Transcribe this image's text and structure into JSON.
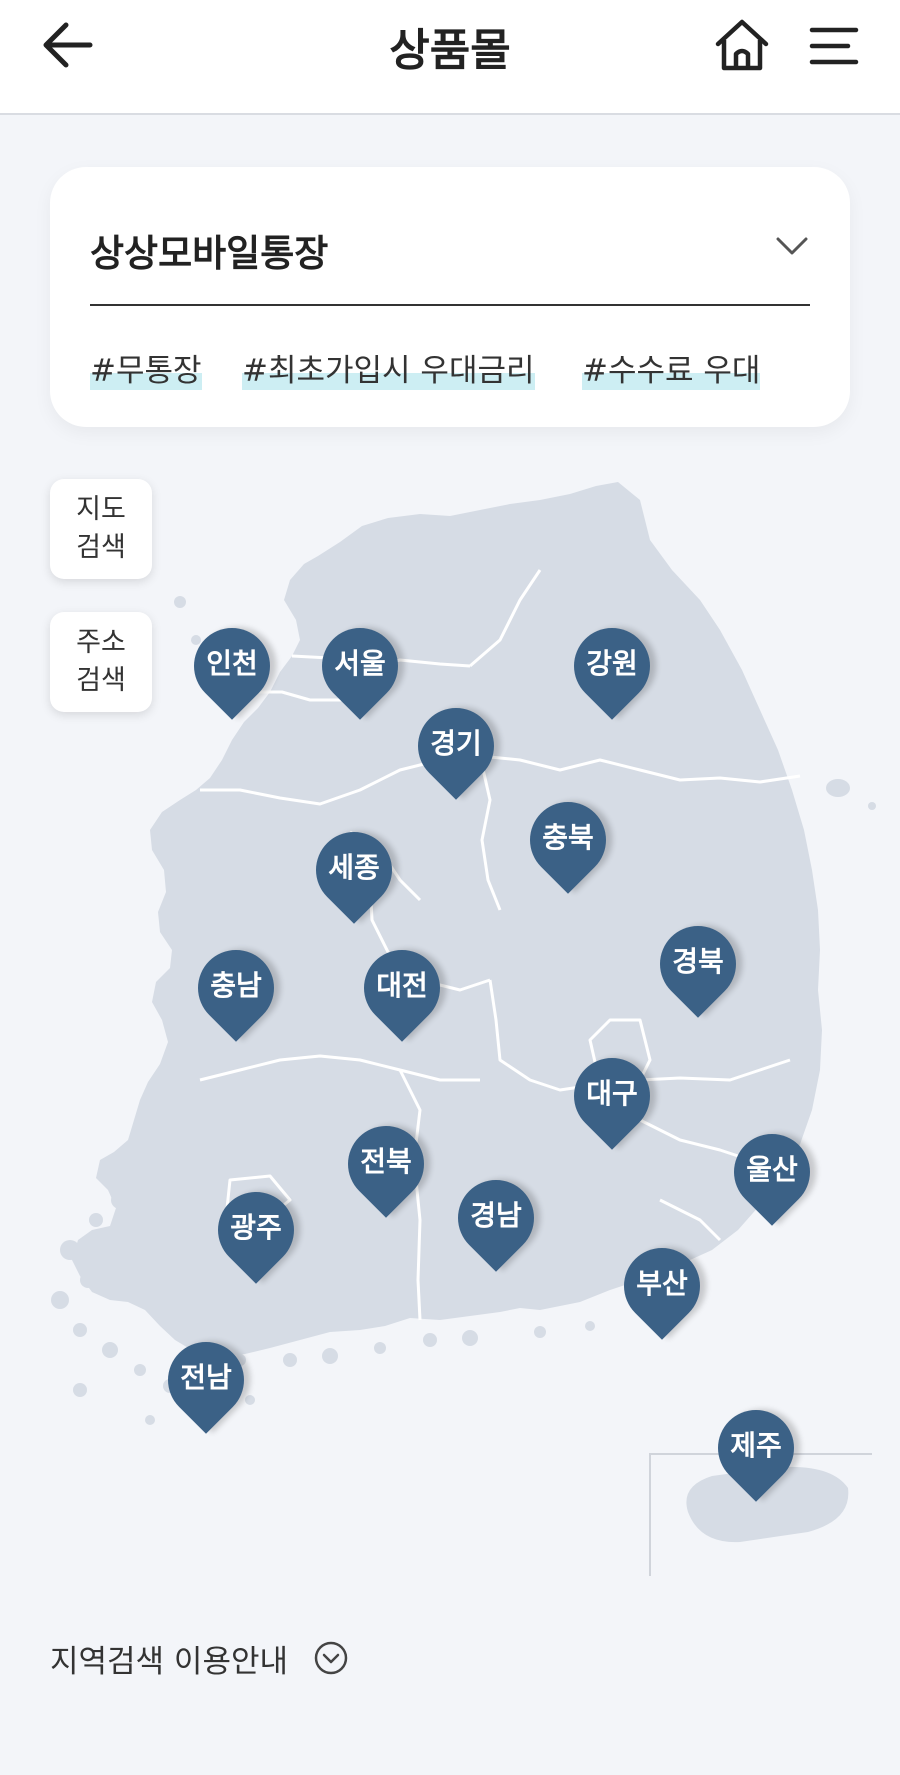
{
  "header": {
    "title": "상품몰",
    "back_icon": "arrow-left-icon",
    "home_icon": "home-icon",
    "menu_icon": "hamburger-menu-icon"
  },
  "product_card": {
    "name": "상상모바일통장",
    "dropdown_icon": "chevron-down-icon",
    "tags": [
      "#무통장",
      "#최초가입시 우대금리",
      "#수수료 우대"
    ]
  },
  "search_buttons": {
    "map_search": "지도\n검색",
    "address_search": "주소\n검색"
  },
  "regions": [
    {
      "key": "incheon",
      "label": "인천"
    },
    {
      "key": "seoul",
      "label": "서울"
    },
    {
      "key": "gangwon",
      "label": "강원"
    },
    {
      "key": "gyeonggi",
      "label": "경기"
    },
    {
      "key": "chungbuk",
      "label": "충북"
    },
    {
      "key": "sejong",
      "label": "세종"
    },
    {
      "key": "chungnam",
      "label": "충남"
    },
    {
      "key": "daejeon",
      "label": "대전"
    },
    {
      "key": "gyeongbuk",
      "label": "경북"
    },
    {
      "key": "daegu",
      "label": "대구"
    },
    {
      "key": "ulsan",
      "label": "울산"
    },
    {
      "key": "jeonbuk",
      "label": "전북"
    },
    {
      "key": "gyeongnam",
      "label": "경남"
    },
    {
      "key": "gwangju",
      "label": "광주"
    },
    {
      "key": "busan",
      "label": "부산"
    },
    {
      "key": "jeonnam",
      "label": "전남"
    },
    {
      "key": "jeju",
      "label": "제주"
    }
  ],
  "guide": {
    "label": "지역검색 이용안내",
    "icon": "circle-chevron-down-icon"
  },
  "colors": {
    "pin": "#3b6186",
    "map_fill": "#d6dce5",
    "background": "#f3f5f9",
    "tag_highlight": "#cdeef3"
  }
}
